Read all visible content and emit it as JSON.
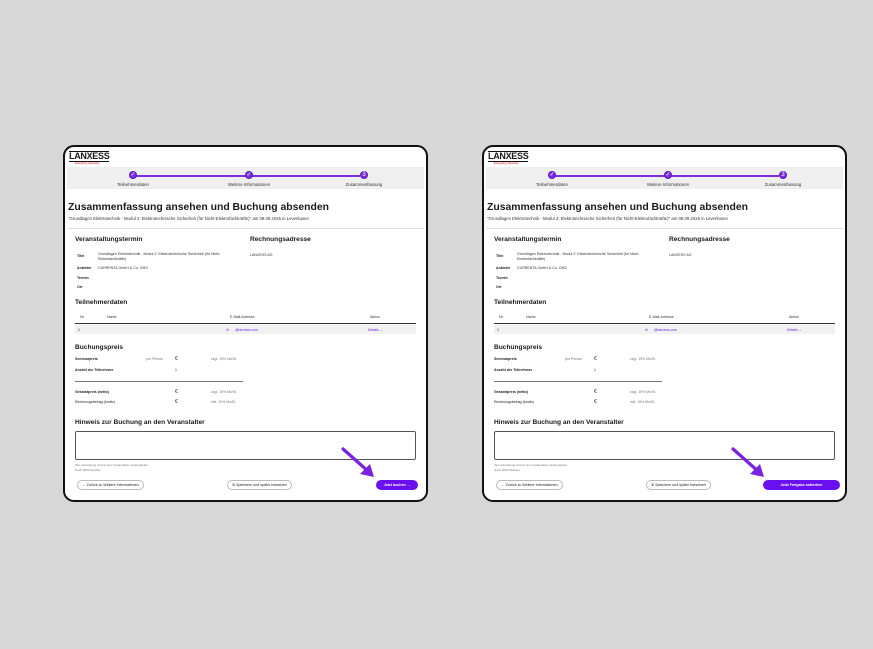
{
  "logo": {
    "text": "LANXESS",
    "tagline": "Energizing Chemistry"
  },
  "steps": [
    "Teilnehmerdaten",
    "Weitere Informationen",
    "Zusammenfassung"
  ],
  "step_check": "✓",
  "step_current": "3",
  "title": "Zusammenfassung ansehen und Buchung absenden",
  "subtitle": "\"Grundlagen Elektrotechnik - Modul 2: Elektrotechnische Sicherheit (für Nicht-Elektrofachkräfte)\" am 08.09.2026 in Leverkusen",
  "event": {
    "heading": "Veranstaltungstermin",
    "rows": [
      {
        "label": "Titel",
        "value": "Grundlagen Elektrotechnik - Modul 2: Elektrotechnische Sicherheit (für Nicht-Elektrofachkräfte)"
      },
      {
        "label": "Anbieter",
        "value": "CURRENTA GmbH & Co. OHG"
      },
      {
        "label": "Termin",
        "value": ""
      },
      {
        "label": "Ort",
        "value": ""
      }
    ]
  },
  "billing": {
    "heading": "Rechnungsadresse",
    "value": "LANXESS AG"
  },
  "participants": {
    "heading": "Teilnehmerdaten",
    "columns": [
      "Nr.",
      "Name",
      "E-Mail-Adresse",
      "Aktion"
    ],
    "rows": [
      {
        "nr": "1",
        "name": "",
        "email": "@lanxess.com",
        "action": "Details"
      }
    ]
  },
  "price": {
    "heading": "Buchungspreis",
    "seminar_label": "Seminarpreis",
    "per_person": "pro Person",
    "currency": "€",
    "vat_plus": "zzgl. 19% MwSt.",
    "count_label": "Anzahl der Teilnehmer",
    "count": "1",
    "net_label": "Gesamtpreis (netto)",
    "gross_label": "Rechnungsbetrag (brutto)",
    "vat_incl": "inkl. 19% MwSt."
  },
  "note": {
    "heading": "Hinweis zur Buchung an den Veranstalter",
    "hint": "Ihre Anmerkung wird an den Veranstalter weitergeleitet.",
    "limit": "Noch 2000 Zeichen"
  },
  "buttons": {
    "back": "Zurück zu Weitere Informationen",
    "save": "Speichern und später fortsetzen",
    "book": "Jetzt buchen",
    "approval": "Jetzt Freigabe anfordern"
  },
  "colors": {
    "accent": "#6a10f0",
    "arrow": "#7a22e0",
    "frame": "#111111",
    "background": "#d7d7d7"
  }
}
